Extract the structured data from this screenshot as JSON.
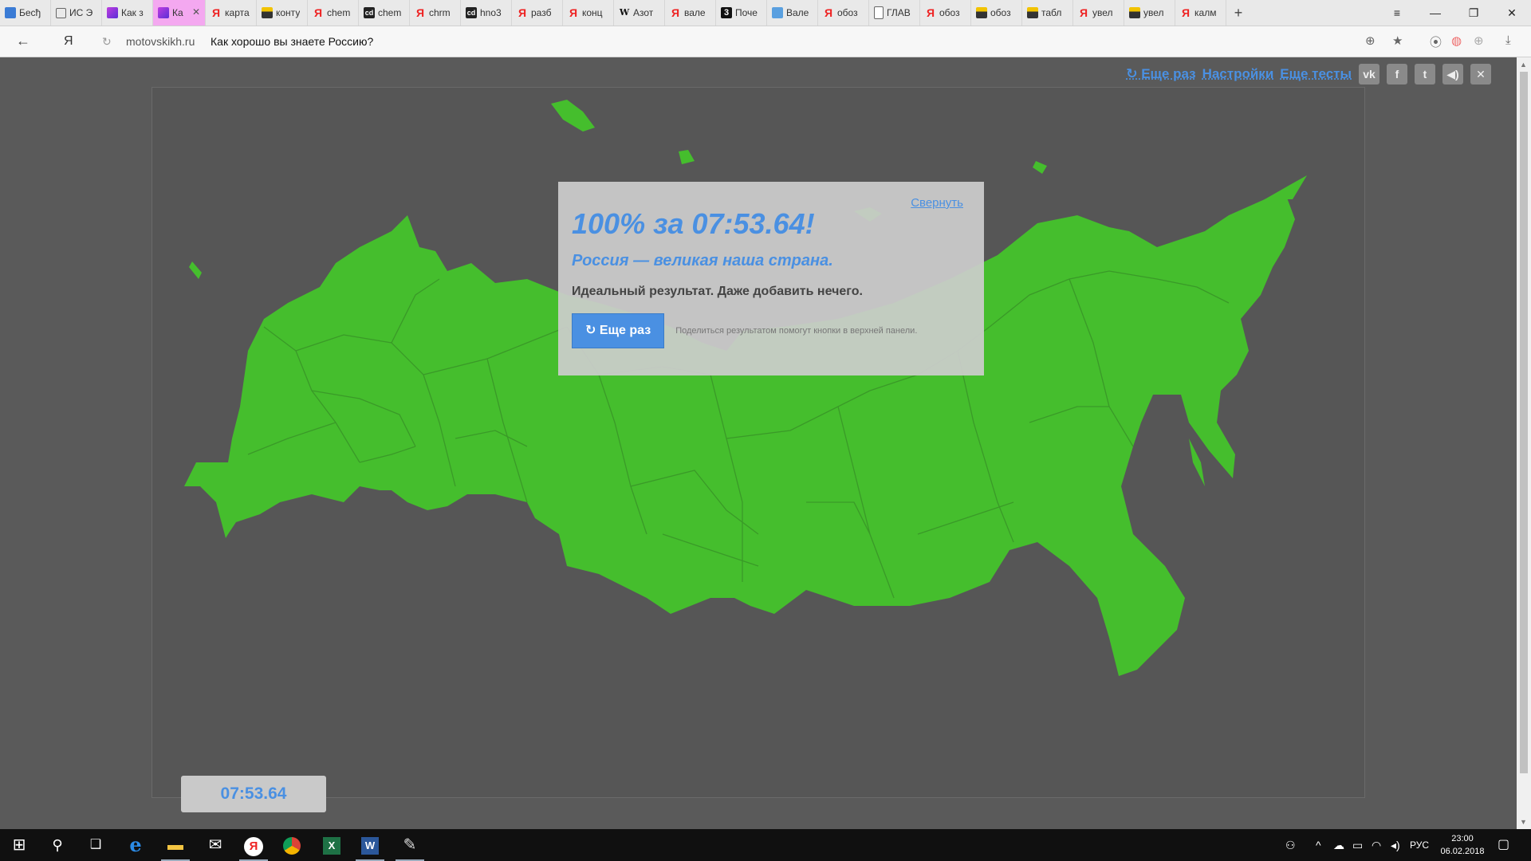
{
  "tabs": [
    {
      "label": "Бесђ",
      "icon": "bubble"
    },
    {
      "label": "ИС Э",
      "icon": "clock"
    },
    {
      "label": "Как з",
      "icon": "purple"
    },
    {
      "label": "Ка",
      "icon": "purple",
      "active": true
    },
    {
      "label": "карта",
      "icon": "ya"
    },
    {
      "label": "конту",
      "icon": "pic"
    },
    {
      "label": "chem",
      "icon": "ya"
    },
    {
      "label": "chem",
      "icon": "cd"
    },
    {
      "label": "chrm",
      "icon": "ya"
    },
    {
      "label": "hno3",
      "icon": "cd"
    },
    {
      "label": "разб",
      "icon": "ya"
    },
    {
      "label": "конц",
      "icon": "ya"
    },
    {
      "label": "Азот",
      "icon": "w"
    },
    {
      "label": "вале",
      "icon": "ya"
    },
    {
      "label": "Поче",
      "icon": "3"
    },
    {
      "label": "Вале",
      "icon": "book"
    },
    {
      "label": "обоз",
      "icon": "ya"
    },
    {
      "label": "ГЛАВ",
      "icon": "doc"
    },
    {
      "label": "обоз",
      "icon": "ya"
    },
    {
      "label": "обоз",
      "icon": "pic"
    },
    {
      "label": "табл",
      "icon": "pic"
    },
    {
      "label": "увел",
      "icon": "ya"
    },
    {
      "label": "увел",
      "icon": "pic"
    },
    {
      "label": "калм",
      "icon": "ya"
    }
  ],
  "icons": {
    "new_tab": "+",
    "menu": "≡",
    "minimize": "—",
    "restore": "❐",
    "close": "✕",
    "back": "←",
    "yandex": "Я",
    "reload": "↻",
    "globe": "⊕",
    "star": "★",
    "ext1": "⦿",
    "ext2": "◍",
    "ext3": "⊕",
    "download": "⤓"
  },
  "address": {
    "domain": "motovskikh.ru",
    "title": "Как хорошо вы знаете Россию?"
  },
  "toplinks": {
    "retry": "↻ Еще раз",
    "settings": "Настройки",
    "more_tests": "Еще тесты"
  },
  "social": {
    "vk": "vk",
    "facebook": "f",
    "twitter": "t",
    "sound": "◀)",
    "close": "✕"
  },
  "result": {
    "collapse": "Свернуть",
    "title": "100% за 07:53.64!",
    "subtitle": "Россия — великая наша страна.",
    "text": "Идеальный результат. Даже добавить нечего.",
    "retry_button": "↻ Еще раз",
    "share_hint": "Поделиться результатом помогут кнопки в верхней панели."
  },
  "timer": "07:53.64",
  "colors": {
    "map_fill": "#45be2d",
    "map_border": "#3a9a28",
    "accent": "#4a90e2"
  },
  "taskbar": {
    "start": "⊞",
    "search": "⚲",
    "task_view": "❑",
    "edge": "e",
    "explorer": "▬",
    "mail": "✉",
    "yandex": "Я",
    "excel": "X",
    "word": "W",
    "paint": "✎"
  },
  "tray": {
    "people": "⚇",
    "chevron": "^",
    "onedrive": "☁",
    "battery": "▭",
    "wifi": "◠",
    "volume": "◂)",
    "lang": "РУС",
    "time": "23:00",
    "date": "06.02.2018",
    "notifications": "▢"
  }
}
